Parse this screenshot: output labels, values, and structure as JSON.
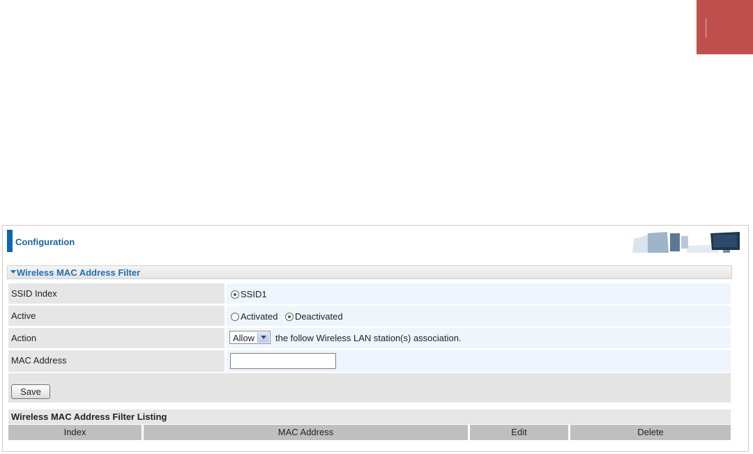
{
  "colors": {
    "corner_tab": "#c0504d",
    "accent_blue": "#1565a8",
    "header_bar": "#0a68b1"
  },
  "config": {
    "title": "Configuration",
    "header_art_icon": "computer-desk-icon"
  },
  "section": {
    "title": "Wireless MAC Address Filter",
    "arrow_icon": "triangle-down-icon"
  },
  "form": {
    "ssid_index": {
      "label": "SSID Index",
      "option": "SSID1",
      "selected": "SSID1"
    },
    "active": {
      "label": "Active",
      "options": [
        "Activated",
        "Deactivated"
      ],
      "selected": "Deactivated"
    },
    "action": {
      "label": "Action",
      "selected": "Allow",
      "suffix": "the follow Wireless LAN station(s) association."
    },
    "mac_address": {
      "label": "MAC Address",
      "value": ""
    }
  },
  "save_label": "Save",
  "listing": {
    "title": "Wireless MAC Address Filter Listing",
    "columns": [
      "Index",
      "MAC Address",
      "Edit",
      "Delete"
    ],
    "rows": []
  }
}
